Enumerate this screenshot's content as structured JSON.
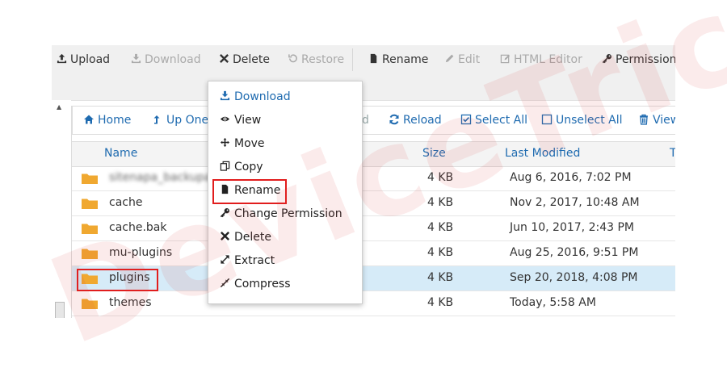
{
  "toolbar": {
    "items": [
      {
        "label": "Upload",
        "icon": "upload-icon",
        "enabled": true
      },
      {
        "label": "Download",
        "icon": "download-icon",
        "enabled": false
      },
      {
        "label": "Delete",
        "icon": "close-icon",
        "enabled": true
      },
      {
        "label": "Restore",
        "icon": "restore-icon",
        "enabled": false
      },
      {
        "label": "Rename",
        "icon": "file-icon",
        "enabled": true
      },
      {
        "label": "Edit",
        "icon": "pencil-icon",
        "enabled": false
      },
      {
        "label": "HTML Editor",
        "icon": "edit-box-icon",
        "enabled": false
      },
      {
        "label": "Permission",
        "icon": "key-icon",
        "enabled": true
      }
    ]
  },
  "nav": {
    "home": "Home",
    "up_one": "Up One L",
    "hidden_fragment": "d",
    "reload": "Reload",
    "select_all": "Select All",
    "unselect_all": "Unselect All",
    "view": "View"
  },
  "table": {
    "columns": {
      "name": "Name",
      "size": "Size",
      "last_modified": "Last Modified",
      "type": "T"
    },
    "rows": [
      {
        "name": "sitenapa_backupa",
        "size": "4 KB",
        "modified": "Aug 6, 2016, 7:02 PM"
      },
      {
        "name": "cache",
        "size": "4 KB",
        "modified": "Nov 2, 2017, 10:48 AM"
      },
      {
        "name": "cache.bak",
        "size": "4 KB",
        "modified": "Jun 10, 2017, 2:43 PM"
      },
      {
        "name": "mu-plugins",
        "size": "4 KB",
        "modified": "Aug 25, 2016, 9:51 PM"
      },
      {
        "name": "plugins",
        "size": "4 KB",
        "modified": "Sep 20, 2018, 4:08 PM"
      },
      {
        "name": "themes",
        "size": "4 KB",
        "modified": "Today, 5:58 AM"
      }
    ]
  },
  "context_menu": {
    "items": [
      {
        "label": "Download",
        "icon": "download-icon"
      },
      {
        "label": "View",
        "icon": "eye-icon"
      },
      {
        "label": "Move",
        "icon": "move-icon"
      },
      {
        "label": "Copy",
        "icon": "copy-icon"
      },
      {
        "label": "Rename",
        "icon": "file-icon"
      },
      {
        "label": "Change Permission",
        "icon": "key-icon"
      },
      {
        "label": "Delete",
        "icon": "close-icon"
      },
      {
        "label": "Extract",
        "icon": "expand-icon"
      },
      {
        "label": "Compress",
        "icon": "compress-icon"
      }
    ]
  },
  "watermark": "DeviceTricks",
  "colors": {
    "link": "#1f6bb0",
    "highlight": "#e11d1d",
    "selected_row": "#d6ebf8",
    "folder": "#f0a830"
  }
}
